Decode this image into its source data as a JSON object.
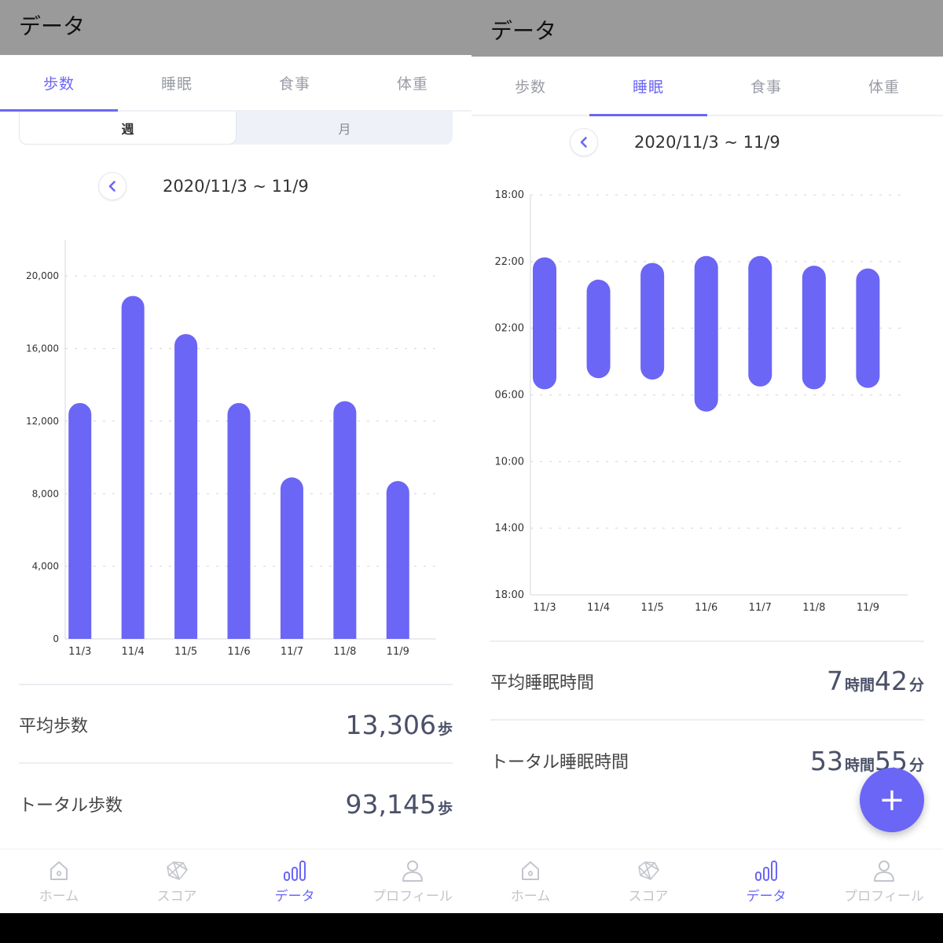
{
  "colors": {
    "accent": "#6b66f5",
    "appbar": "#9a9a9a",
    "bar": "#6b66f5"
  },
  "screens": [
    {
      "title": "データ",
      "tabs": [
        "歩数",
        "睡眠",
        "食事",
        "体重"
      ],
      "active_tab": 0,
      "segments": [
        "週",
        "月"
      ],
      "date_range": "2020/11/3 ~ 11/9",
      "stats": [
        {
          "label": "平均歩数",
          "value": "13,306",
          "unit": "歩"
        },
        {
          "label": "トータル歩数",
          "value": "93,145",
          "unit": "歩"
        }
      ]
    },
    {
      "title": "データ",
      "tabs": [
        "歩数",
        "睡眠",
        "食事",
        "体重"
      ],
      "active_tab": 1,
      "date_range": "2020/11/3 ~ 11/9",
      "stats": [
        {
          "label": "平均睡眠時間",
          "h": "7",
          "h_unit": "時間",
          "m": "42",
          "m_unit": "分"
        },
        {
          "label": "トータル睡眠時間",
          "h": "53",
          "h_unit": "時間",
          "m": "55",
          "m_unit": "分"
        }
      ],
      "fab": "+"
    }
  ],
  "bottom_nav": [
    {
      "label": "ホーム",
      "icon": "home-icon"
    },
    {
      "label": "スコア",
      "icon": "score-gem-icon"
    },
    {
      "label": "データ",
      "icon": "bar-chart-icon"
    },
    {
      "label": "プロフィール",
      "icon": "profile-icon"
    }
  ],
  "chart_data": [
    {
      "type": "bar",
      "categories": [
        "11/3",
        "11/4",
        "11/5",
        "11/6",
        "11/7",
        "11/8",
        "11/9"
      ],
      "values": [
        13000,
        18900,
        16800,
        13000,
        8900,
        13100,
        8700
      ],
      "yticks": [
        "0",
        "4,000",
        "8,000",
        "12,000",
        "16,000",
        "20,000"
      ],
      "ylim": [
        0,
        22000
      ],
      "grid": true
    },
    {
      "type": "bar",
      "categories": [
        "11/3",
        "11/4",
        "11/5",
        "11/6",
        "11/7",
        "11/8",
        "11/9"
      ],
      "ranges": [
        [
          "21:45",
          "05:40"
        ],
        [
          "23:05",
          "05:00"
        ],
        [
          "22:05",
          "05:05"
        ],
        [
          "21:40",
          "07:00"
        ],
        [
          "21:40",
          "05:30"
        ],
        [
          "22:15",
          "05:40"
        ],
        [
          "22:25",
          "05:35"
        ]
      ],
      "yticks": [
        "18:00",
        "22:00",
        "02:00",
        "06:00",
        "10:00",
        "14:00",
        "18:00"
      ],
      "ylim_hours": [
        0,
        24
      ],
      "grid": true
    }
  ]
}
